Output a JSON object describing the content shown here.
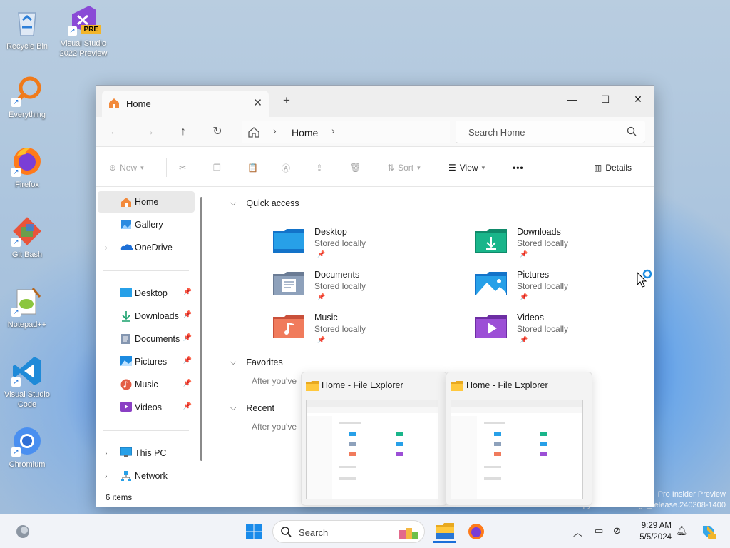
{
  "desktop": {
    "icons": [
      {
        "label": "Recycle Bin",
        "icon": "recycle-bin-icon"
      },
      {
        "label": "Visual Studio 2022 Preview",
        "icon": "visual-studio-icon",
        "badge": "PRE"
      },
      {
        "label": "Everything",
        "icon": "everything-icon"
      },
      {
        "label": "Firefox",
        "icon": "firefox-icon"
      },
      {
        "label": "Git Bash",
        "icon": "git-bash-icon"
      },
      {
        "label": "Notepad++",
        "icon": "notepad-plus-plus-icon"
      },
      {
        "label": "Visual Studio Code",
        "icon": "vscode-icon"
      },
      {
        "label": "Chromium",
        "icon": "chromium-icon"
      }
    ],
    "watermark": {
      "line1": "Pro Insider Preview",
      "line2": "Evaluation copy. Build 26100.ge_release.240308-1400"
    }
  },
  "window": {
    "tab": {
      "label": "Home",
      "close": "✕"
    },
    "new_tab": "+",
    "controls": {
      "minimize": "—",
      "maximize": "☐",
      "close": "✕"
    },
    "nav": {
      "back": "←",
      "forward": "→",
      "up": "↑",
      "refresh": "↻"
    },
    "address": {
      "crumb": "Home",
      "sep": "›"
    },
    "search": {
      "placeholder": "Search Home"
    },
    "commands": {
      "new": "New",
      "sort": "Sort",
      "view": "View",
      "more": "•••",
      "details": "Details"
    },
    "sidebar": {
      "items": [
        {
          "label": "Home",
          "icon": "home-icon",
          "selected": true
        },
        {
          "label": "Gallery",
          "icon": "gallery-icon"
        },
        {
          "label": "OneDrive",
          "icon": "onedrive-icon",
          "expandable": true
        }
      ],
      "pinned": [
        {
          "label": "Desktop",
          "icon": "desktop-folder-icon"
        },
        {
          "label": "Downloads",
          "icon": "downloads-folder-icon"
        },
        {
          "label": "Documents",
          "icon": "documents-folder-icon"
        },
        {
          "label": "Pictures",
          "icon": "pictures-folder-icon"
        },
        {
          "label": "Music",
          "icon": "music-folder-icon"
        },
        {
          "label": "Videos",
          "icon": "videos-folder-icon"
        }
      ],
      "devices": [
        {
          "label": "This PC",
          "icon": "this-pc-icon"
        },
        {
          "label": "Network",
          "icon": "network-icon"
        }
      ],
      "status": "6 items"
    },
    "content": {
      "quick_access": {
        "title": "Quick access",
        "items": [
          {
            "name": "Desktop",
            "sub": "Stored locally",
            "icon": "desktop-folder-icon",
            "color": "#1a86d4"
          },
          {
            "name": "Downloads",
            "sub": "Stored locally",
            "icon": "downloads-folder-icon",
            "color": "#15a37e"
          },
          {
            "name": "Documents",
            "sub": "Stored locally",
            "icon": "documents-folder-icon",
            "color": "#7d8fa6"
          },
          {
            "name": "Pictures",
            "sub": "Stored locally",
            "icon": "pictures-folder-icon",
            "color": "#1a86d4"
          },
          {
            "name": "Music",
            "sub": "Stored locally",
            "icon": "music-folder-icon",
            "color": "#e06a4e"
          },
          {
            "name": "Videos",
            "sub": "Stored locally",
            "icon": "videos-folder-icon",
            "color": "#8a3fc4"
          }
        ]
      },
      "favorites": {
        "title": "Favorites",
        "hint": "After you've"
      },
      "recent": {
        "title": "Recent",
        "hint": "After you've"
      }
    }
  },
  "thumbnails": [
    {
      "title": "Home - File Explorer"
    },
    {
      "title": "Home - File Explorer"
    }
  ],
  "taskbar": {
    "search_placeholder": "Search",
    "time": "9:29 AM",
    "date": "5/5/2024"
  }
}
